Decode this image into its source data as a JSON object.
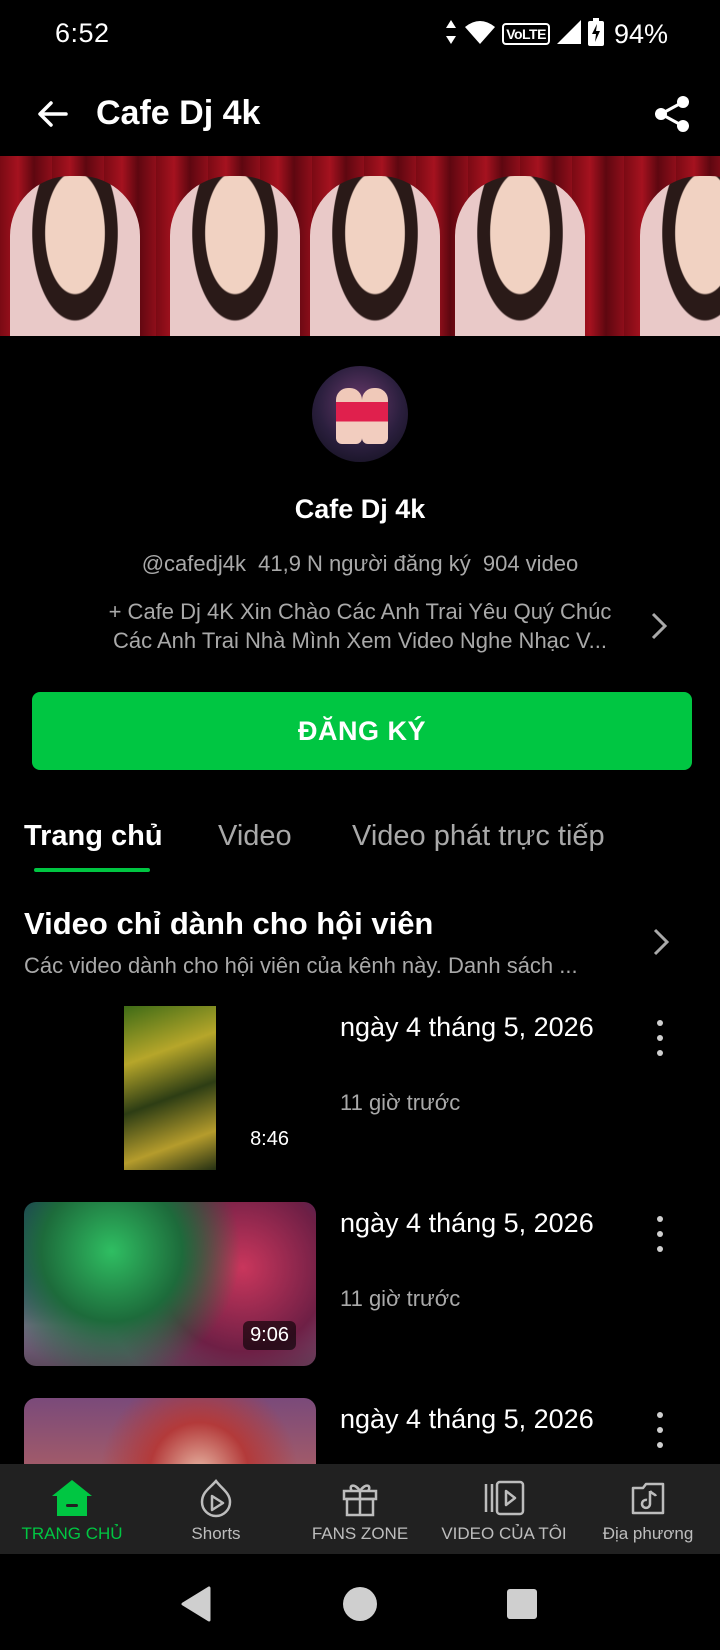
{
  "status_bar": {
    "time": "6:52",
    "network_label": "VoLTE",
    "battery_percent": "94%"
  },
  "app_bar": {
    "title": "Cafe Dj 4k"
  },
  "channel": {
    "name": "Cafe Dj 4k",
    "handle": "@cafedj4k",
    "subscribers": "41,9 N người đăng ký",
    "videos_count": "904 video",
    "description_line1": "+ Cafe Dj 4K Xin Chào Các Anh Trai Yêu Quý Chúc",
    "description_line2": "Các Anh Trai Nhà Mình Xem Video Nghe Nhạc V..."
  },
  "subscribe_button": {
    "label": "ĐĂNG KÝ"
  },
  "tabs": [
    {
      "label": "Trang chủ",
      "active": true
    },
    {
      "label": "Video",
      "active": false
    },
    {
      "label": "Video phát trực tiếp",
      "active": false
    }
  ],
  "section": {
    "title": "Video chỉ dành cho hội viên",
    "subtitle": "Các video dành cho hội viên của kênh này. Danh sách ..."
  },
  "videos": [
    {
      "title": "ngày 4 tháng 5, 2026",
      "time_ago": "11 giờ trước",
      "duration": "8:46"
    },
    {
      "title": "ngày 4 tháng 5, 2026",
      "time_ago": "11 giờ trước",
      "duration": "9:06"
    },
    {
      "title": "ngày 4 tháng 5, 2026",
      "time_ago": "",
      "duration": ""
    }
  ],
  "bottom_nav": [
    {
      "label": "TRANG CHỦ",
      "icon": "home-icon",
      "active": true
    },
    {
      "label": "Shorts",
      "icon": "shorts-icon",
      "active": false
    },
    {
      "label": "FANS ZONE",
      "icon": "gift-icon",
      "active": false
    },
    {
      "label": "VIDEO CỦA TÔI",
      "icon": "my-videos-icon",
      "active": false
    },
    {
      "label": "Địa phương",
      "icon": "local-music-icon",
      "active": false
    }
  ],
  "colors": {
    "accent": "#00c642",
    "background": "#000000",
    "secondary_text": "#a9a9a9",
    "nav_background": "#212121"
  }
}
